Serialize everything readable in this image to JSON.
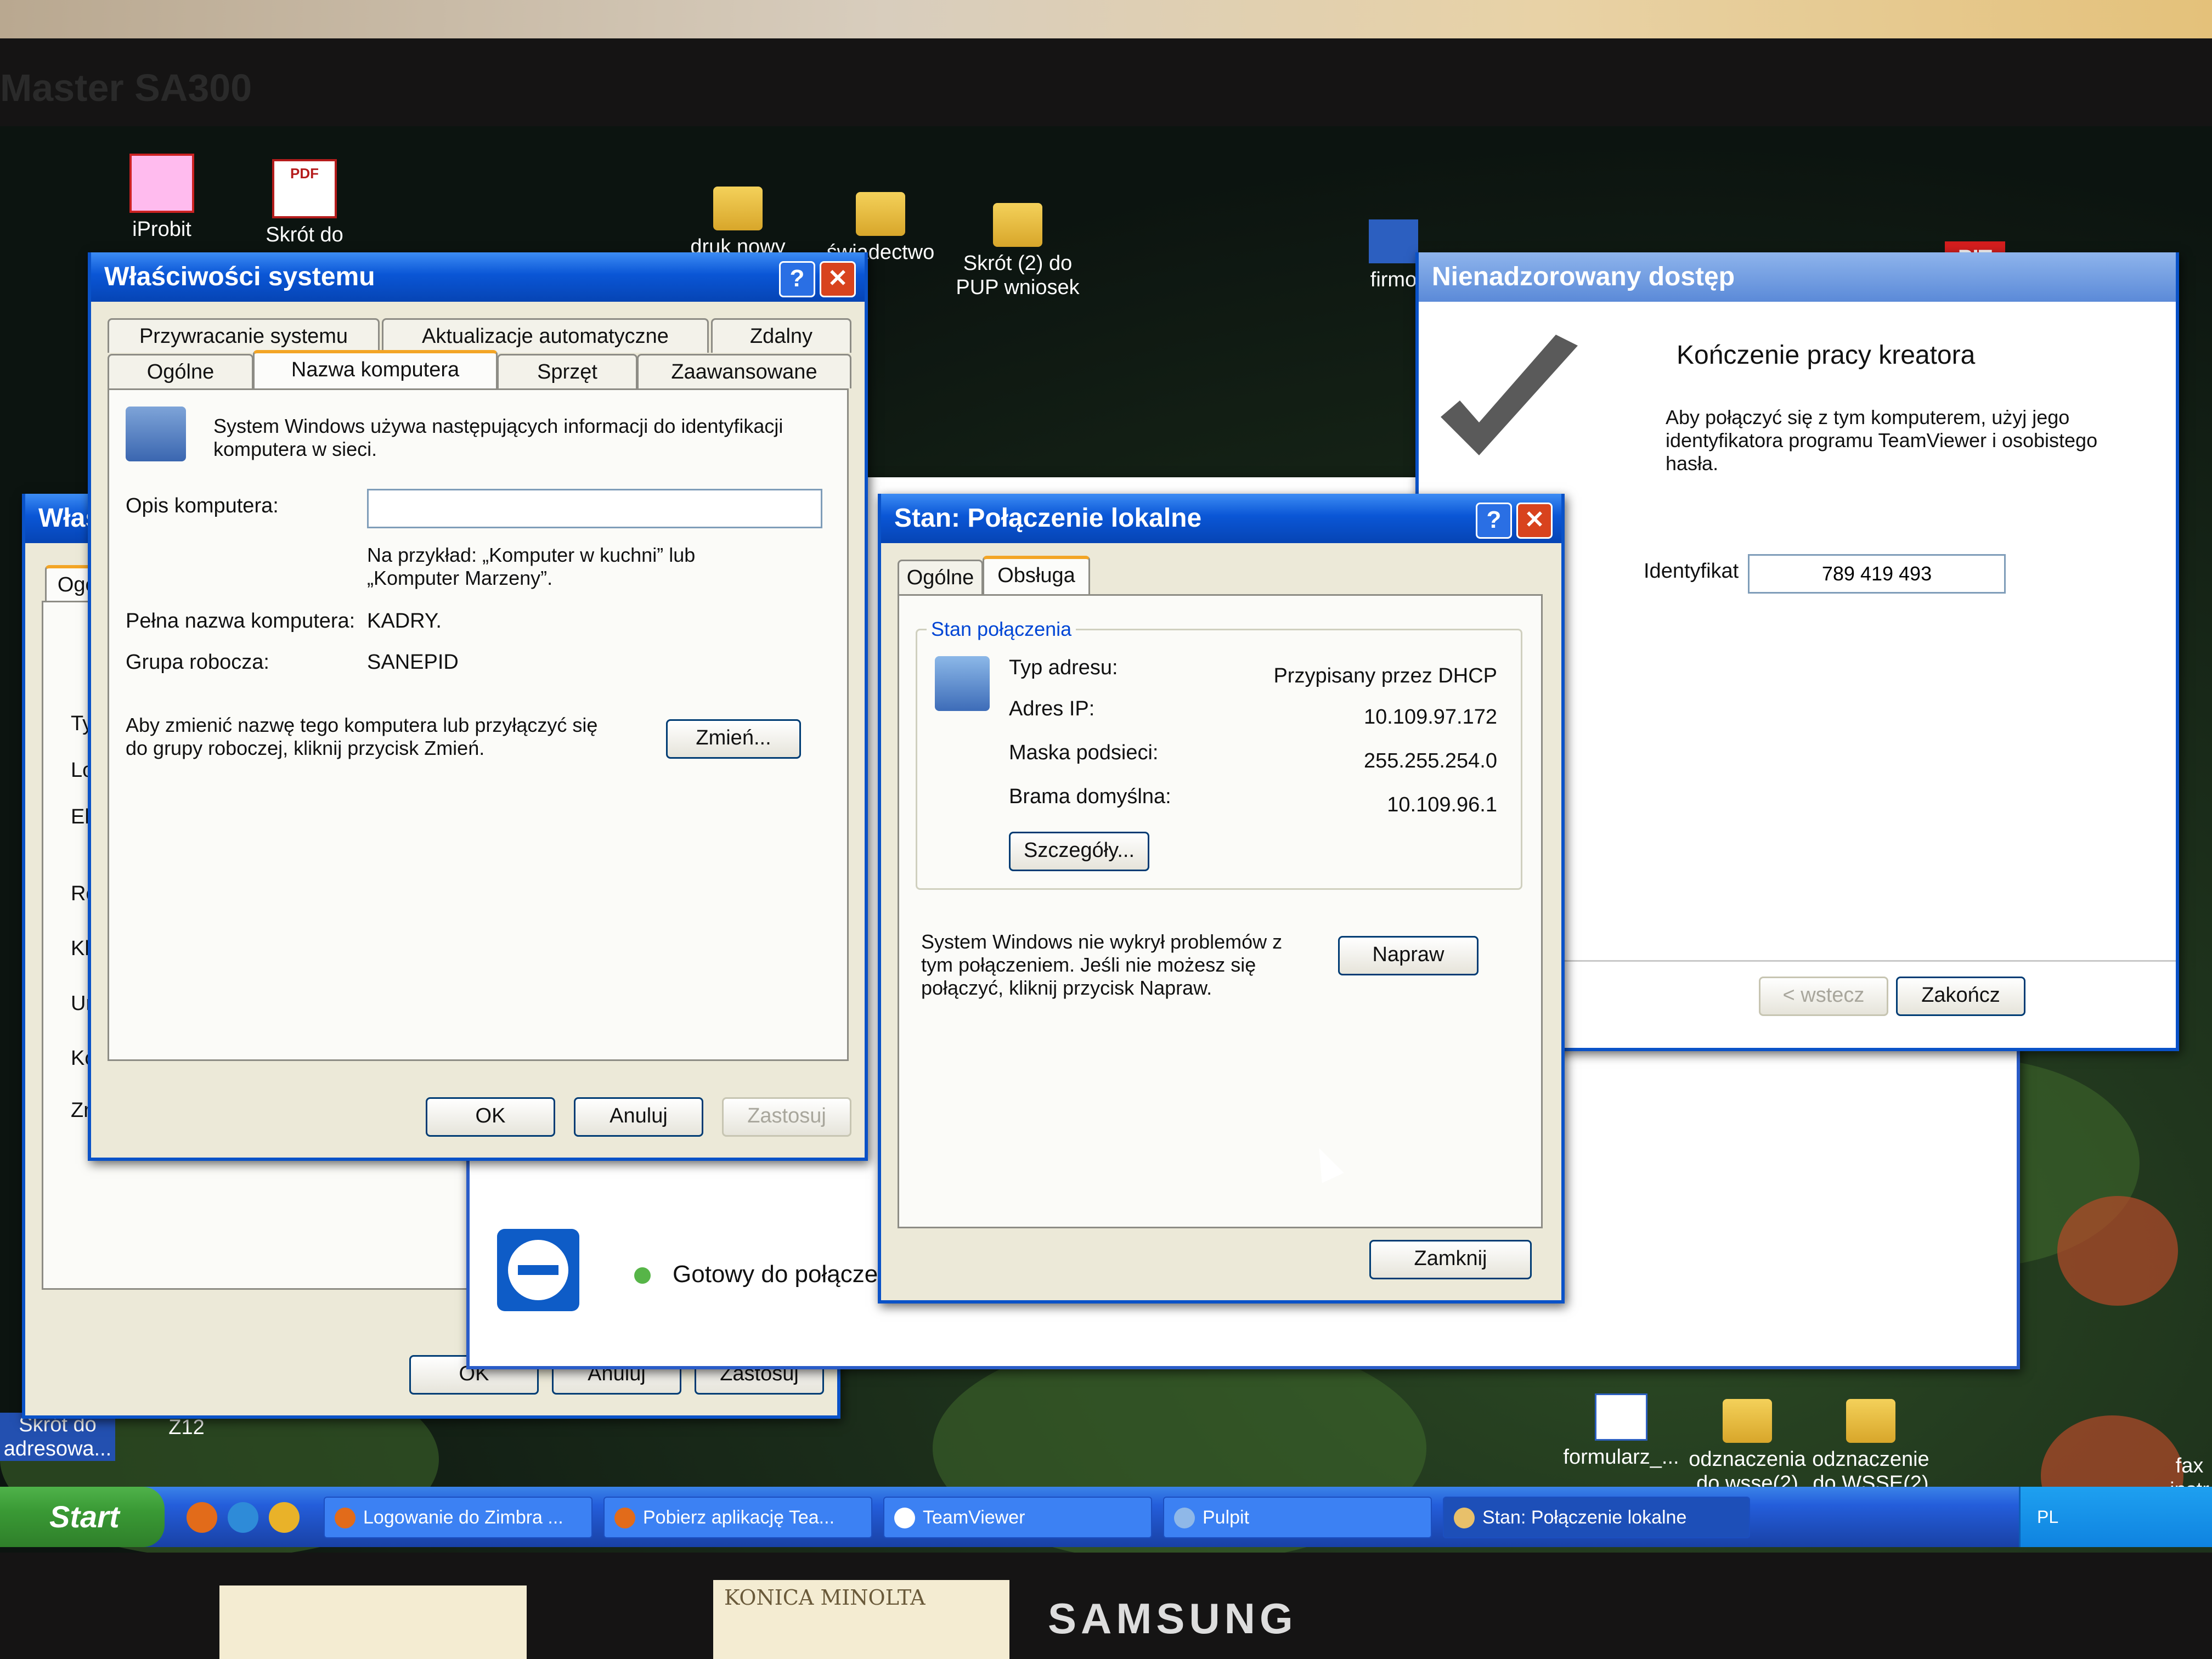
{
  "monitor_model": "Master SA300",
  "brand": "SAMSUNG",
  "desktop_icons": [
    {
      "id": "iprobit",
      "label": "iProbit"
    },
    {
      "id": "skrot_do_pdf",
      "label": "Skrót do"
    },
    {
      "id": "druk_nowy",
      "label": "druk nowy"
    },
    {
      "id": "swiadectwo",
      "label": "świadectwo"
    },
    {
      "id": "skrot2",
      "label": "Skrót (2) do PUP wniosek"
    },
    {
      "id": "firmo",
      "label": "firmo"
    },
    {
      "id": "pit",
      "label": "PIT"
    },
    {
      "id": "formularz",
      "label": "formularz_..."
    },
    {
      "id": "odznaczenia",
      "label": "odznaczenia do wsse(2)"
    },
    {
      "id": "odznaczenie",
      "label": "odznaczenie do WSSE(2)"
    },
    {
      "id": "skrot_adresowa",
      "label": "Skrót do adresowa..."
    },
    {
      "id": "z12",
      "label": "Z12"
    },
    {
      "id": "fax",
      "label": "fax instr"
    }
  ],
  "system_properties": {
    "title": "Właściwości systemu",
    "tabs_row1": [
      "Przywracanie systemu",
      "Aktualizacje automatyczne",
      "Zdalny"
    ],
    "tabs_row2": [
      "Ogólne",
      "Nazwa komputera",
      "Sprzęt",
      "Zaawansowane"
    ],
    "intro": "System Windows używa następujących informacji do identyfikacji komputera w sieci.",
    "description_label": "Opis komputera:",
    "description_value": "",
    "example": "Na przykład: „Komputer w kuchni” lub „Komputer Marzeny”.",
    "full_name_label": "Pełna nazwa komputera:",
    "full_name_value": "KADRY.",
    "workgroup_label": "Grupa robocza:",
    "workgroup_value": "SANEPID",
    "rename_text": "Aby zmienić nazwę tego komputera lub przyłączyć się do grupy roboczej, kliknij przycisk Zmień.",
    "change_button": "Zmień...",
    "ok": "OK",
    "cancel": "Anuluj",
    "apply": "Zastosuj"
  },
  "behind_window": {
    "title": "Właś",
    "tab": "Ogól",
    "rows": [
      "Typ",
      "Lok",
      "Ele",
      "Ro:",
      "Kla",
      "Uru",
      "Kor",
      "Zr"
    ],
    "ok": "OK",
    "cancel": "Anuluj",
    "apply": "Zastosuj"
  },
  "teamviewer_status": "Gotowy do połączenia (bezpieczne połączenie)",
  "connection_status": {
    "title": "Stan: Połączenie lokalne",
    "tabs": [
      "Ogólne",
      "Obsługa"
    ],
    "group_label": "Stan połączenia",
    "rows": [
      {
        "label": "Typ adresu:",
        "value": "Przypisany przez DHCP"
      },
      {
        "label": "Adres IP:",
        "value": "10.109.97.172"
      },
      {
        "label": "Maska podsieci:",
        "value": "255.255.254.0"
      },
      {
        "label": "Brama domyślna:",
        "value": "10.109.96.1"
      }
    ],
    "details_button": "Szczegóły...",
    "repair_text": "System Windows nie wykrył problemów z tym połączeniem. Jeśli nie możesz się połączyć, kliknij przycisk Napraw.",
    "repair_button": "Napraw",
    "close_button": "Zamknij"
  },
  "unattended": {
    "title": "Nienadzorowany dostęp",
    "heading": "Kończenie pracy kreatora",
    "text": "Aby połączyć się z tym komputerem, użyj jego identyfikatora programu TeamViewer i osobistego hasła.",
    "id_label": "Identyfikat",
    "id_value": "789 419 493",
    "back_button": "< wstecz",
    "finish_button": "Zakończ"
  },
  "taskbar": {
    "start": "Start",
    "items": [
      "Logowanie do Zimbra ...",
      "Pobierz aplikację Tea...",
      "TeamViewer",
      "Pulpit",
      "Stan: Połączenie lokalne"
    ],
    "language": "PL"
  },
  "sticky_notes": [
    "KONICA MINOLTA"
  ],
  "colors": {
    "xp_blue": "#0a56d6",
    "window_bg": "#ece9d8",
    "start_green": "#3a9a35",
    "close_red": "#d8431e"
  }
}
